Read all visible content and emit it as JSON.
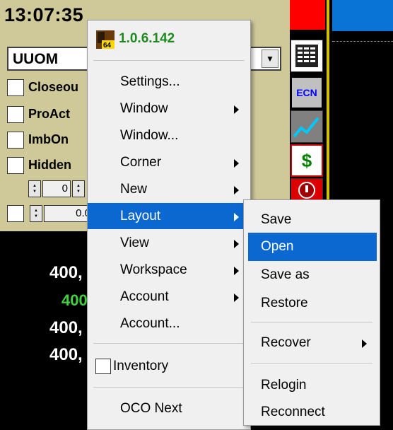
{
  "app": {
    "clock": "13:07:35",
    "symbol": "UUOM",
    "options": [
      "Closeou",
      "ProAct",
      "ImbOn",
      "Hidden"
    ],
    "spinner1_value": "0",
    "spinner2_value": "0.0",
    "prices": [
      "400,",
      "400",
      "400,",
      "400,"
    ],
    "toolbar": {
      "ecn_label": "ECN",
      "dollar_label": "$"
    }
  },
  "context_menu": {
    "version": "1.0.6.142",
    "logo_badge": "64",
    "items": [
      {
        "label": "Settings...",
        "submenu": false
      },
      {
        "label": "Window",
        "submenu": true
      },
      {
        "label": "Window...",
        "submenu": false
      },
      {
        "label": "Corner",
        "submenu": true
      },
      {
        "label": "New",
        "submenu": true
      },
      {
        "label": "Layout",
        "submenu": true,
        "highlighted": true
      },
      {
        "label": "View",
        "submenu": true
      },
      {
        "label": "Workspace",
        "submenu": true
      },
      {
        "label": "Account",
        "submenu": true
      },
      {
        "label": "Account...",
        "submenu": false
      }
    ],
    "inventory_label": "Inventory",
    "oco_label": "OCO Next"
  },
  "layout_submenu": {
    "items": [
      {
        "label": "Save"
      },
      {
        "label": "Open",
        "highlighted": true
      },
      {
        "label": "Save as"
      },
      {
        "label": "Restore"
      },
      {
        "label": "Recover",
        "submenu": true
      },
      {
        "label": "Relogin"
      },
      {
        "label": "Reconnect"
      }
    ]
  },
  "colors": {
    "highlight": "#0a68d0",
    "panel": "#cfc99a",
    "version_green": "#1e8a1e"
  }
}
